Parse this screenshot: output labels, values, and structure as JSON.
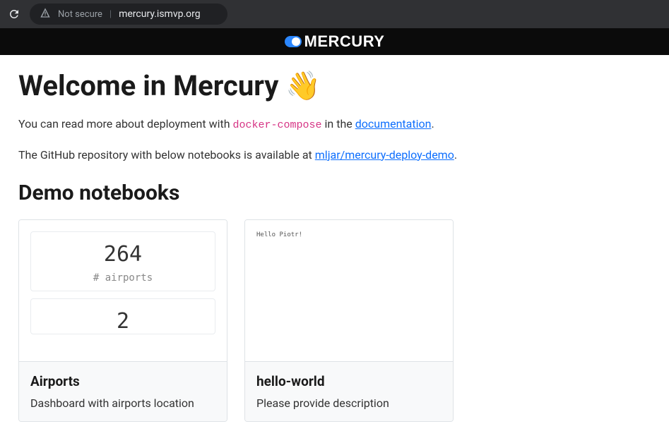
{
  "browser": {
    "not_secure_label": "Not secure",
    "url": "mercury.ismvp.org"
  },
  "brand": {
    "name": "MERCURY"
  },
  "page": {
    "title": "Welcome in Mercury 👋",
    "intro1_pre": "You can read more about deployment with ",
    "intro1_code": "docker-compose",
    "intro1_mid": " in the ",
    "intro1_link": "documentation",
    "intro1_post": ".",
    "intro2_pre": "The GitHub repository with below notebooks is available at ",
    "intro2_link": "mljar/mercury-deploy-demo",
    "intro2_post": ".",
    "demo_heading": "Demo notebooks"
  },
  "notebooks": [
    {
      "title": "Airports",
      "description": "Dashboard with airports location",
      "preview": {
        "stat1_value": "264",
        "stat1_label": "# airports",
        "stat2_value": "2"
      }
    },
    {
      "title": "hello-world",
      "description": "Please provide description",
      "preview": {
        "text": "Hello Piotr!"
      }
    }
  ]
}
